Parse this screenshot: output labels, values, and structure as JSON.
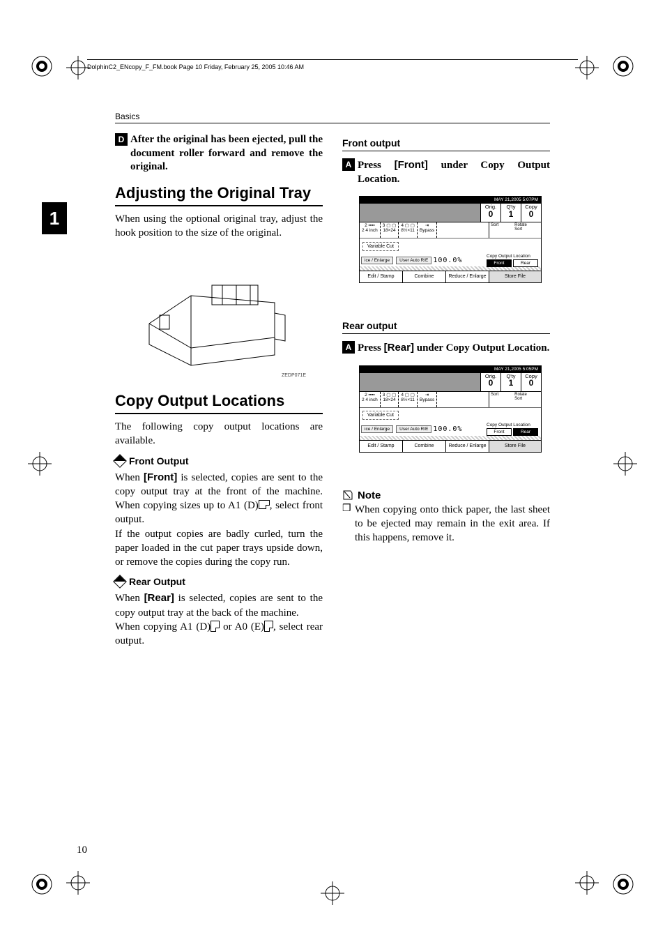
{
  "runhead": "DolphinC2_ENcopy_F_FM.book  Page 10  Friday, February 25, 2005  10:46 AM",
  "running_head": "Basics",
  "chapter_tab": "1",
  "page_number": "10",
  "left": {
    "step4_num": "D",
    "step4_text_a": "After the original has been ejected, pull the document roller forward and remove the original.",
    "section1": "Adjusting the Original Tray",
    "body1": "When using the optional original tray, adjust the hook position to the size of the original.",
    "fig_caption": "ZEDP071E",
    "section2": "Copy Output Locations",
    "body2": "The following copy output locations are available.",
    "front_head": "Front Output",
    "front_body": "When [Front] is selected, copies are sent to the copy output tray at the front of the machine. When copying sizes up to A1 (D) ▢, select front output.\nIf the output copies are badly curled, turn the paper loaded in the cut paper trays upside down, or remove the copies during the copy run.",
    "rear_head": "Rear Output",
    "rear_body_a": "When [Rear] is selected, copies are sent to the copy output tray at the back of the machine.",
    "rear_body_b": "When copying A1 (D) ▢ or A0 (E) ▢, select rear output."
  },
  "right": {
    "sub1": "Front output",
    "step_a_num": "A",
    "step_a_text": "Press [Front] under Copy Output Location.",
    "sub2": "Rear output",
    "step_b_num": "A",
    "step_b_text": "Press [Rear] under Copy Output Location.",
    "note_head": "Note",
    "note_item": "When copying onto thick paper, the last sheet to be ejected may remain in the exit area. If this happens, remove it."
  },
  "screen1": {
    "timestamp": "MAY   21,2005   5:07PM",
    "orig_lbl": "Orig.",
    "orig_val": "0",
    "qty_lbl": "Q'ty",
    "qty_val": "1",
    "copy_lbl": "Copy",
    "copy_val": "0",
    "paper1a": "2 ▪▪▪▪",
    "paper1b": "2 4 inch",
    "paper2a": "3 ▢ ▢",
    "paper2b": "18×24",
    "paper3a": "4 ▢ ▢",
    "paper3b": "8½×11",
    "bypass": "Bypass",
    "sort": "Sort",
    "rotate_sort": "Rotate Sort",
    "var_cut": "Variable Cut",
    "re_enl": "ice / Enlarge",
    "user_auto": "User Auto R/E",
    "ratio": "100.0%",
    "output_lbl": "Copy Output Location",
    "front": "Front",
    "rear": "Rear",
    "edit": "Edit / Stamp",
    "combine": "Combine",
    "reduce": "Reduce / Enlarge",
    "store": "Store File"
  },
  "screen2": {
    "timestamp": "MAY   21,2005   5:05PM",
    "orig_lbl": "Orig.",
    "orig_val": "0",
    "qty_lbl": "Q'ty",
    "qty_val": "1",
    "copy_lbl": "Copy",
    "copy_val": "0",
    "paper1a": "2 ▪▪▪▪",
    "paper1b": "2 4 inch",
    "paper2a": "3 ▢ ▢",
    "paper2b": "18×24",
    "paper3a": "4 ▢ ▢",
    "paper3b": "8½×11",
    "bypass": "Bypass",
    "sort": "Sort",
    "rotate_sort": "Rotate Sort",
    "var_cut": "Variable Cut",
    "re_enl": "ice / Enlarge",
    "user_auto": "User Auto R/E",
    "ratio": "100.0%",
    "output_lbl": "Copy Output Location",
    "front": "Front",
    "rear": "Rear",
    "edit": "Edit / Stamp",
    "combine": "Combine",
    "reduce": "Reduce / Enlarge",
    "store": "Store File"
  }
}
